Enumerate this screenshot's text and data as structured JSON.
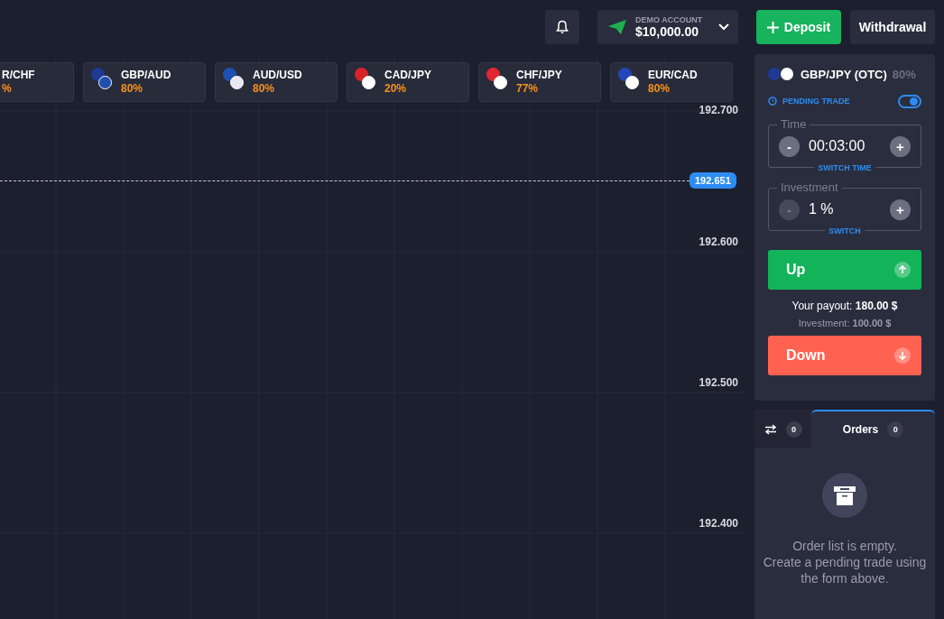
{
  "header": {
    "account": {
      "label": "DEMO ACCOUNT",
      "balance": "$10,000.00"
    },
    "deposit": "Deposit",
    "withdrawal": "Withdrawal"
  },
  "assets": [
    {
      "pair": "R/CHF",
      "payout": "%",
      "partial": true
    },
    {
      "pair": "GBP/AUD",
      "payout": "80%",
      "partial": false,
      "flags": [
        {
          "color": "#1f3a93"
        },
        {
          "color": "#1f4fb0"
        }
      ]
    },
    {
      "pair": "AUD/USD",
      "payout": "80%",
      "partial": false,
      "flags": [
        {
          "color": "#1f4fb0"
        },
        {
          "color": "#e8e8f0"
        }
      ]
    },
    {
      "pair": "CAD/JPY",
      "payout": "20%",
      "partial": false,
      "flags": [
        {
          "color": "#d8232a"
        },
        {
          "color": "#ffffff"
        }
      ]
    },
    {
      "pair": "CHF/JPY",
      "payout": "77%",
      "partial": false,
      "flags": [
        {
          "color": "#e3262f"
        },
        {
          "color": "#ffffff"
        }
      ]
    },
    {
      "pair": "EUR/CAD",
      "payout": "80%",
      "partial": false,
      "flags": [
        {
          "color": "#2446b8"
        },
        {
          "color": "#ffffff"
        }
      ]
    }
  ],
  "chart": {
    "price_labels": [
      "192.700",
      "192.600",
      "192.500",
      "192.400"
    ],
    "current_price": "192.651"
  },
  "trade": {
    "pair": "GBP/JPY (OTC)",
    "payout": "80%",
    "pending_label": "PENDING TRADE",
    "pending_on": true,
    "fields": [
      {
        "legend": "Time",
        "value": "00:03:00",
        "minus": "-",
        "plus": "+",
        "switch": "SWITCH TIME",
        "minus_disabled": false
      },
      {
        "legend": "Investment",
        "value": "1 %",
        "minus": "-",
        "plus": "+",
        "switch": "SWITCH",
        "minus_disabled": true
      }
    ],
    "up": "Up",
    "payout_line": "Your payout: **180.00 $**",
    "investment_line": "Investment: **100.00 $**",
    "down": "Down"
  },
  "orders": {
    "tabs": [
      {
        "kind": "icon",
        "count": "0",
        "selected": false
      },
      {
        "kind": "text",
        "label": "Orders",
        "count": "0",
        "selected": true
      }
    ],
    "empty_title": "Order list is empty.",
    "empty_text": "Create a pending trade using the form above."
  }
}
